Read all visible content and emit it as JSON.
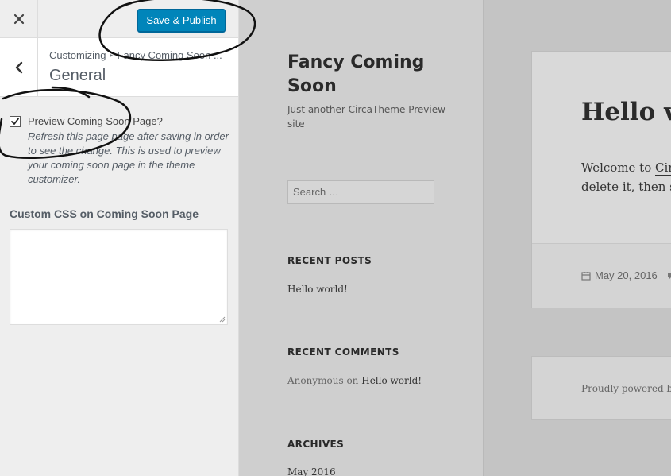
{
  "header": {
    "publish_label": "Save & Publish"
  },
  "section": {
    "breadcrumb_root": "Customizing",
    "breadcrumb_current": "Fancy Coming Soon ...",
    "title": "General"
  },
  "controls": {
    "preview_checkbox_label": "Preview Coming Soon Page?",
    "preview_checkbox_checked": true,
    "preview_description": "Refresh this page page after saving in order to see the change. This is used to preview your coming soon page in the theme customizer.",
    "custom_css_label": "Custom CSS on Coming Soon Page",
    "custom_css_value": ""
  },
  "preview": {
    "site_title": "Fancy Coming Soon",
    "site_tagline": "Just another CircaTheme Preview site",
    "search_placeholder": "Search …",
    "recent_posts_title": "RECENT POSTS",
    "recent_posts": [
      "Hello world!"
    ],
    "recent_comments_title": "RECENT COMMENTS",
    "recent_comment_author": "Anonymous",
    "recent_comment_on": "on",
    "recent_comment_post": "Hello world!",
    "archives_title": "ARCHIVES",
    "archives": [
      "May 2016"
    ],
    "post_title": "Hello w",
    "post_excerpt_line1_prefix": "Welcome to ",
    "post_excerpt_line1_link": "Circ",
    "post_excerpt_line2": "delete it, then st",
    "post_date": "May 20, 2016",
    "footer_text": "Proudly powered by"
  },
  "colors": {
    "accent": "#0085ba",
    "annotation_ink": "#111111"
  }
}
